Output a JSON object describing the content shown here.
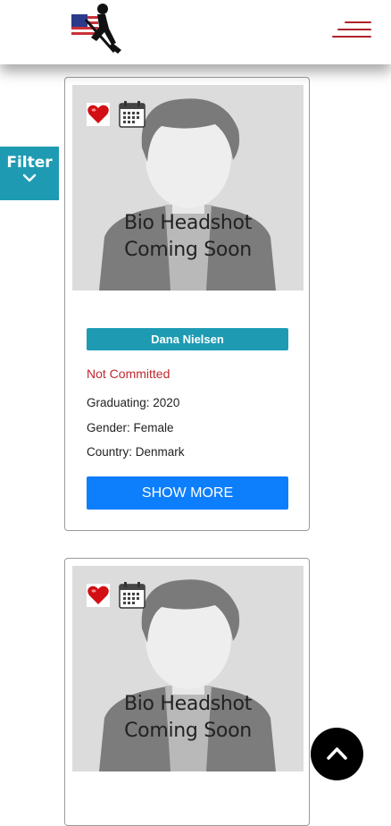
{
  "header": {
    "logo_icon": "rower-flag-logo-icon",
    "menu_icon": "hamburger-menu-icon"
  },
  "filter": {
    "label": "Filter",
    "icon": "chevron-down-icon"
  },
  "cards": [
    {
      "photo_caption_line1": "Bio Headshot",
      "photo_caption_line2": "Coming Soon",
      "name": "Dana Nielsen",
      "status": "Not Committed",
      "graduating": "Graduating: 2020",
      "gender": "Gender: Female",
      "country": "Country: Denmark",
      "show_more": "SHOW MORE"
    },
    {
      "photo_caption_line1": "Bio Headshot",
      "photo_caption_line2": "Coming Soon"
    }
  ],
  "scroll_top_icon": "chevron-up-icon",
  "colors": {
    "accent": "#1e9bb3",
    "primary_button": "#0d7efc",
    "status_red": "#c0282d",
    "menu_red": "#b0222a"
  }
}
